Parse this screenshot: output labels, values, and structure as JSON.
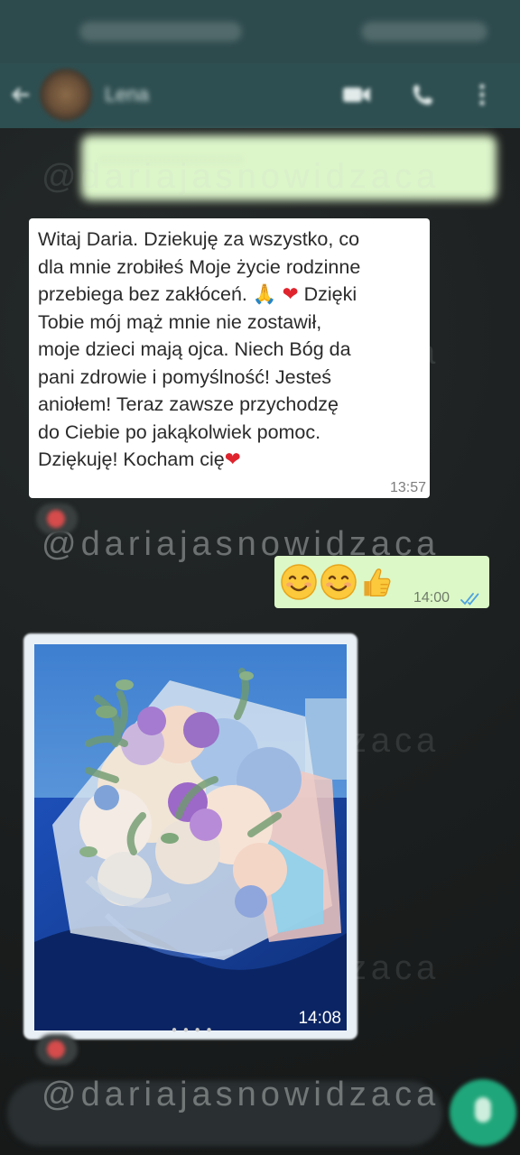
{
  "status_bar": {
    "blurred": true
  },
  "header": {
    "contact_name": "Lena",
    "icons": [
      "back-arrow-icon",
      "avatar",
      "video-call-icon",
      "phone-icon",
      "more-vert-icon"
    ]
  },
  "chat": {
    "messages": [
      {
        "type": "incoming-text",
        "lines": [
          "Witaj Daria. Dziekuję za wszystko, co",
          "dla mnie zrobiłeś Moje życie rodzinne",
          "Tobie mój mąż mnie nie zostawił,",
          "moje dzieci mają ojca. Niech Bóg da",
          "pani zdrowie i pomyślność! Jesteś",
          "aniołem! Teraz zawsze przychodzę",
          "do Ciebie po jakąkolwiek pomoc."
        ],
        "line3_text": "przebiega bez zakłóceń.",
        "line3_emoji_pray": "🙏",
        "line3_emoji_heart": "❤",
        "line3_tail": "Dzięki",
        "last_line_text": "Dziękuję! Kocham cię",
        "last_line_emoji": "❤",
        "time": "13:57"
      },
      {
        "type": "outgoing-emoji",
        "emojis": [
          "smiling-face-icon",
          "smiling-face-icon",
          "thumbs-up-icon"
        ],
        "time": "14:00",
        "status": "read"
      },
      {
        "type": "incoming-photo",
        "subject": "flower bouquet on car hood",
        "time": "14:08"
      }
    ]
  },
  "watermark": {
    "text": "@dariajasnowidzaca"
  },
  "colors": {
    "header_bg": "#2e4f51",
    "chat_bg": "#1b1e1e",
    "incoming_bubble": "#ffffff",
    "outgoing_bubble": "#dcf8c6",
    "read_ticks": "#4fa3e0",
    "mic_button": "#1fa67a"
  }
}
